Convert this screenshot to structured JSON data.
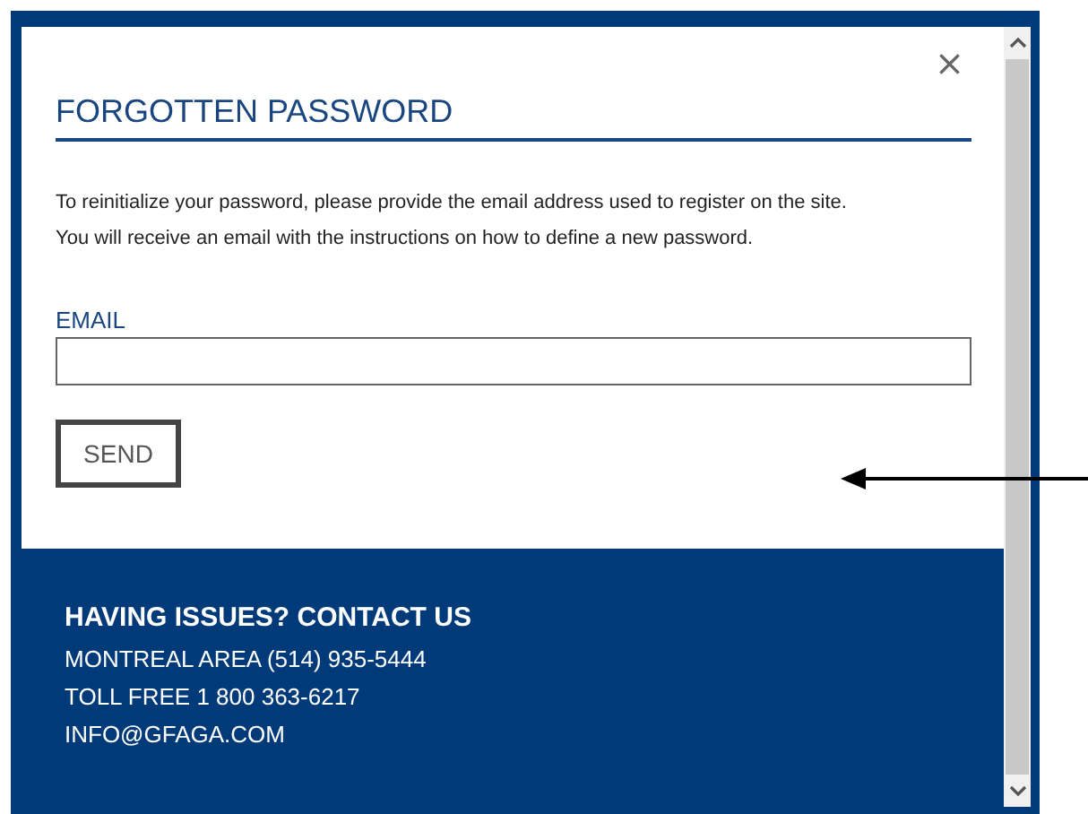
{
  "dialog": {
    "close": "×",
    "title": "FORGOTTEN PASSWORD",
    "instructions": [
      "To reinitialize your password, please provide the email address used to register on the site.",
      "You will receive an email with the instructions on how to define a new password."
    ],
    "email": {
      "label": "EMAIL"
    },
    "button": "SEND"
  },
  "footer": {
    "heading": "HAVING ISSUES? CONTACT US",
    "lines": [
      "MONTREAL AREA (514) 935-5444",
      "TOLL FREE 1 800 363-6217",
      "INFO@GFAGA.COM"
    ]
  }
}
